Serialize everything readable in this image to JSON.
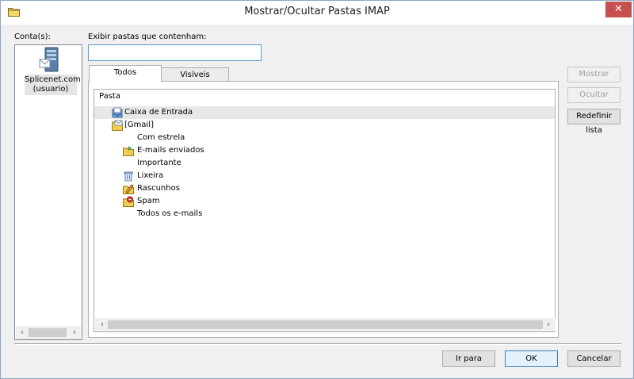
{
  "window": {
    "title": "Mostrar/Ocultar Pastas IMAP",
    "close_label": "✕"
  },
  "accounts": {
    "label": "Conta(s):",
    "items": [
      {
        "name_line1": "Splicenet.com",
        "name_line2": "(usuario)",
        "icon": "server-icon"
      }
    ]
  },
  "filter": {
    "label": "Exibir pastas que contenham:",
    "value": "",
    "placeholder": ""
  },
  "tabs": [
    {
      "label": "Todos",
      "active": true
    },
    {
      "label": "Visíveis",
      "active": false
    }
  ],
  "folder_tree": {
    "column_header": "Pasta",
    "rows": [
      {
        "label": "Caixa de Entrada",
        "icon": "inbox-icon",
        "level": 0,
        "selected": true
      },
      {
        "label": "[Gmail]",
        "icon": "mail-folder-icon",
        "level": 0,
        "selected": false
      },
      {
        "label": "Com estrela",
        "icon": "",
        "level": 1,
        "selected": false
      },
      {
        "label": "E-mails enviados",
        "icon": "sent-folder-icon",
        "level": 1,
        "selected": false
      },
      {
        "label": "Importante",
        "icon": "",
        "level": 1,
        "selected": false
      },
      {
        "label": "Lixeira",
        "icon": "trash-icon",
        "level": 1,
        "selected": false
      },
      {
        "label": "Rascunhos",
        "icon": "drafts-icon",
        "level": 1,
        "selected": false
      },
      {
        "label": "Spam",
        "icon": "spam-icon",
        "level": 1,
        "selected": false
      },
      {
        "label": "Todos os e-mails",
        "icon": "",
        "level": 1,
        "selected": false
      }
    ]
  },
  "side_buttons": {
    "show": "Mostrar",
    "hide": "Ocultar",
    "reset": "Redefinir lista"
  },
  "bottom_buttons": {
    "goto": "Ir para",
    "ok": "OK",
    "cancel": "Cancelar"
  },
  "scroll_arrows": {
    "left": "‹",
    "right": "›"
  },
  "colors": {
    "accent": "#3c7fb1",
    "close": "#c7504f",
    "selection": "#e8e8e8"
  }
}
